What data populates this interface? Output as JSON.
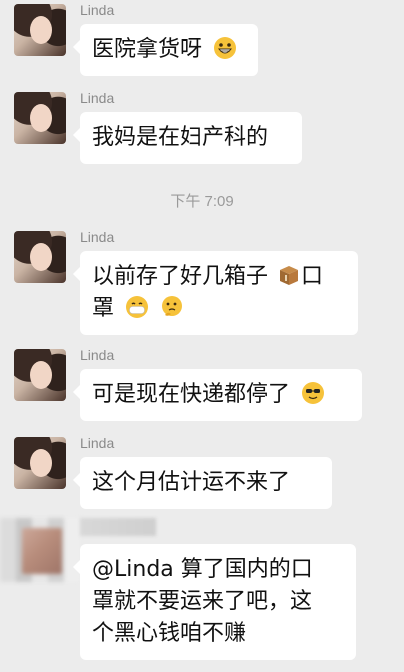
{
  "colors": {
    "background": "#ececec",
    "bubble": "#ffffff",
    "sender_name": "#8a8a8a",
    "timestamp": "#9a9a9a"
  },
  "messages": [
    {
      "sender": "Linda",
      "lines": [
        "医院拿货呀"
      ],
      "emoji": [
        "grinning-face-icon"
      ]
    },
    {
      "sender": "Linda",
      "lines": [
        "我妈是在妇产科的"
      ],
      "emoji": []
    },
    {
      "sender": "Linda",
      "lines": [
        "以前存了好几箱子",
        "口",
        "罩"
      ],
      "emoji": [
        "package-icon",
        "mask-face-icon",
        "thinking-face-icon"
      ]
    },
    {
      "sender": "Linda",
      "lines": [
        "可是现在快递都停了"
      ],
      "emoji": [
        "sunglasses-face-icon"
      ]
    },
    {
      "sender": "Linda",
      "lines": [
        "这个月估计运不来了"
      ],
      "emoji": []
    }
  ],
  "timestamp": "下午 7:09",
  "reply": {
    "lines": [
      "@Linda  算了国内的口",
      "罩就不要运来了吧，这",
      "个黑心钱咱不赚"
    ]
  }
}
